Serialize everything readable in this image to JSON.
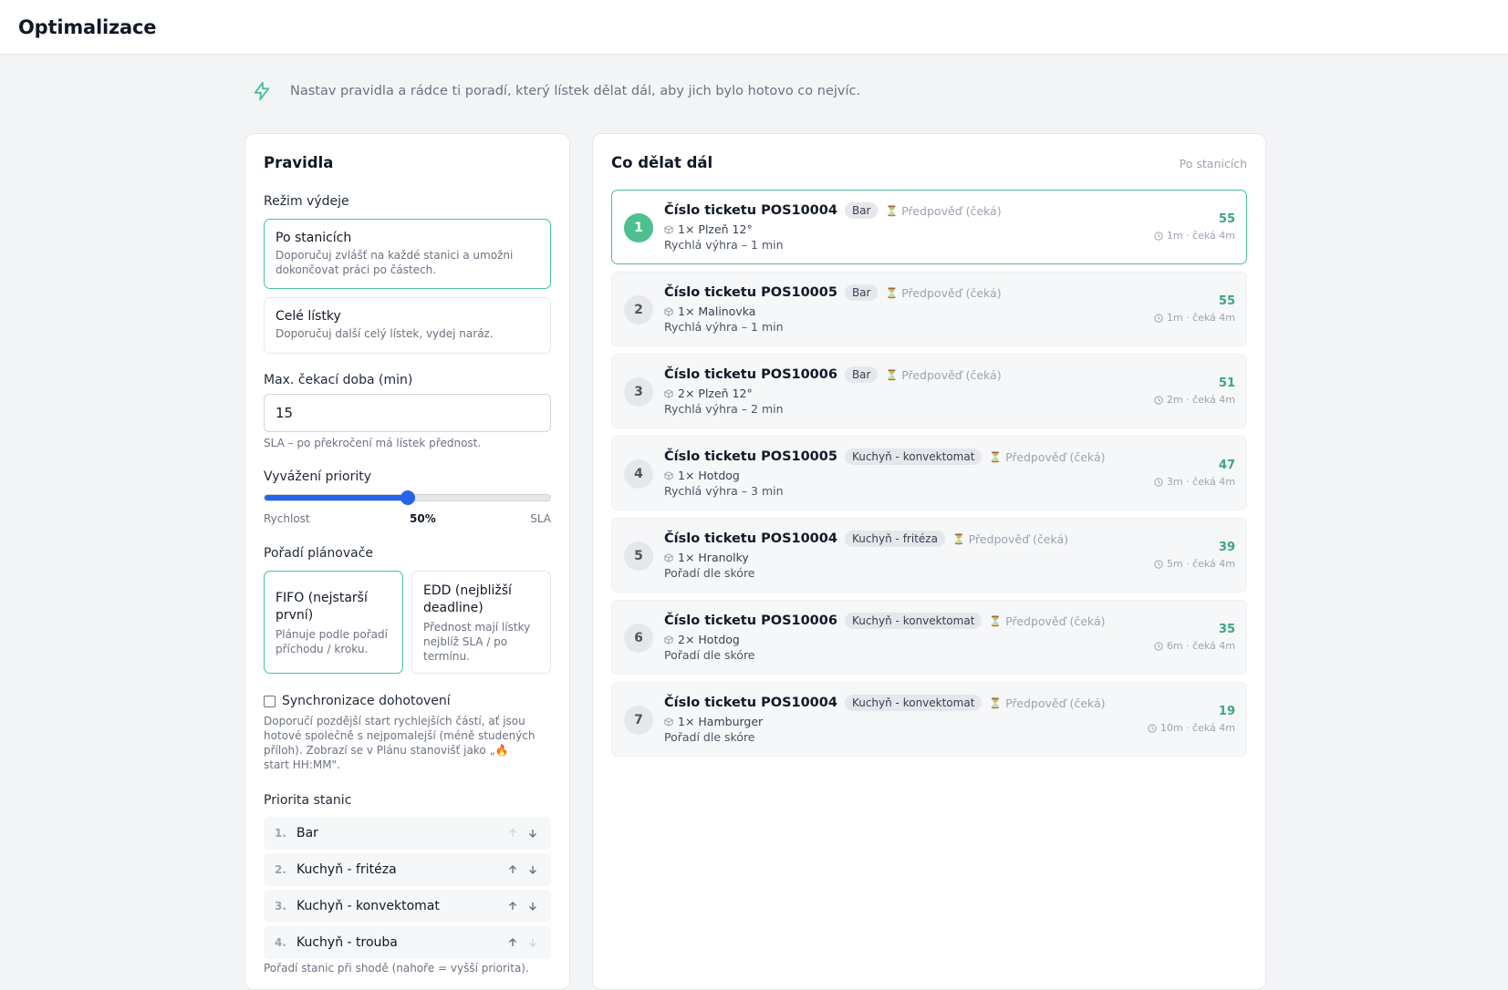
{
  "header": {
    "title": "Optimalizace"
  },
  "hint": {
    "text": "Nastav pravidla a rádce ti poradí, který lístek dělat dál, aby jich bylo hotovo co nejvíc."
  },
  "rules": {
    "title": "Pravidla",
    "mode_label": "Režim výdeje",
    "modes": [
      {
        "title": "Po stanicích",
        "desc": "Doporučuj zvlášť na každé stanici a umožni dokončovat práci po částech.",
        "active": true
      },
      {
        "title": "Celé lístky",
        "desc": "Doporučuj další celý lístek, vydej naráz.",
        "active": false
      }
    ],
    "max_wait_label": "Max. čekací doba (min)",
    "max_wait_value": "15",
    "max_wait_help": "SLA – po překročení má lístek přednost.",
    "balance_label": "Vyvážení priority",
    "balance_left": "Rychlost",
    "balance_value": "50%",
    "balance_fraction": 0.5,
    "balance_right": "SLA",
    "planner_label": "Pořadí plánovače",
    "planners": [
      {
        "title": "FIFO (nejstarší první)",
        "desc": "Plánuje podle pořadí příchodu / kroku.",
        "active": true
      },
      {
        "title": "EDD (nejbližší deadline)",
        "desc": "Přednost mají lístky nejblíž SLA / po termínu.",
        "active": false
      }
    ],
    "sync_label": "Synchronizace dohotovení",
    "sync_checked": false,
    "sync_help": "Doporučí pozdější start rychlejších částí, ať jsou hotové společně s nejpomalejší (méně studených příloh). Zobrazí se v Plánu stanovišť jako „🔥 start HH:MM\".",
    "station_priority_label": "Priorita stanic",
    "stations": [
      {
        "num": "1.",
        "name": "Bar"
      },
      {
        "num": "2.",
        "name": "Kuchyň - fritéza"
      },
      {
        "num": "3.",
        "name": "Kuchyň - konvektomat"
      },
      {
        "num": "4.",
        "name": "Kuchyň - trouba"
      }
    ],
    "station_priority_help": "Pořadí stanic při shodě (nahoře = vyšší priorita)."
  },
  "next": {
    "title": "Co dělat dál",
    "mode_caption": "Po stanicích",
    "tasks": [
      {
        "rank": "1",
        "ticket": "Číslo ticketu POS10004",
        "station": "Bar",
        "forecast": "Předpověď (čeká)",
        "item": "1× Plzeň 12°",
        "reason": "Rychlá výhra – 1 min",
        "score": "55",
        "meta": "1m · čeká 4m",
        "active": true
      },
      {
        "rank": "2",
        "ticket": "Číslo ticketu POS10005",
        "station": "Bar",
        "forecast": "Předpověď (čeká)",
        "item": "1× Malinovka",
        "reason": "Rychlá výhra – 1 min",
        "score": "55",
        "meta": "1m · čeká 4m",
        "active": false
      },
      {
        "rank": "3",
        "ticket": "Číslo ticketu POS10006",
        "station": "Bar",
        "forecast": "Předpověď (čeká)",
        "item": "2× Plzeň 12°",
        "reason": "Rychlá výhra – 2 min",
        "score": "51",
        "meta": "2m · čeká 4m",
        "active": false
      },
      {
        "rank": "4",
        "ticket": "Číslo ticketu POS10005",
        "station": "Kuchyň - konvektomat",
        "forecast": "Předpověď (čeká)",
        "item": "1× Hotdog",
        "reason": "Rychlá výhra – 3 min",
        "score": "47",
        "meta": "3m · čeká 4m",
        "active": false
      },
      {
        "rank": "5",
        "ticket": "Číslo ticketu POS10004",
        "station": "Kuchyň - fritéza",
        "forecast": "Předpověď (čeká)",
        "item": "1× Hranolky",
        "reason": "Pořadí dle skóre",
        "score": "39",
        "meta": "5m · čeká 4m",
        "active": false
      },
      {
        "rank": "6",
        "ticket": "Číslo ticketu POS10006",
        "station": "Kuchyň - konvektomat",
        "forecast": "Předpověď (čeká)",
        "item": "2× Hotdog",
        "reason": "Pořadí dle skóre",
        "score": "35",
        "meta": "6m · čeká 4m",
        "active": false
      },
      {
        "rank": "7",
        "ticket": "Číslo ticketu POS10004",
        "station": "Kuchyň - konvektomat",
        "forecast": "Předpověď (čeká)",
        "item": "1× Hamburger",
        "reason": "Pořadí dle skóre",
        "score": "19",
        "meta": "10m · čeká 4m",
        "active": false
      }
    ]
  },
  "colors": {
    "accent": "#4cc18f",
    "slider": "#2563eb",
    "score": "#3aa87a"
  },
  "icons": {
    "hint": "lightning-icon",
    "item": "box-icon",
    "meta": "clock-icon",
    "forecast": "hourglass-icon"
  }
}
